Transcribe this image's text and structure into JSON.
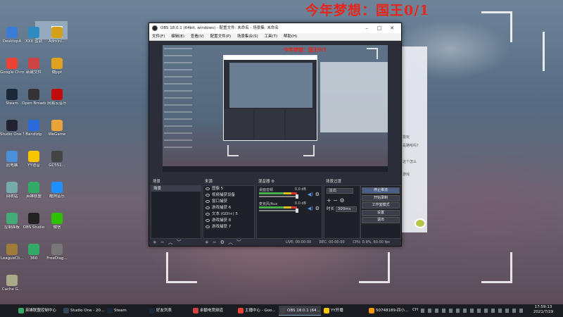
{
  "overlay": {
    "title": "今年梦想：国王0/1"
  },
  "desktop_icons": [
    {
      "label": "DesktopA",
      "color": "#3a7bd5"
    },
    {
      "label": "XXX 蓝调",
      "color": "#2e8bc0"
    },
    {
      "label": "Admini...",
      "color": "#d4a017"
    },
    {
      "label": "Google Chrome",
      "color": "#ea4335"
    },
    {
      "label": "新建文件",
      "color": "#c44"
    },
    {
      "label": "微ppt",
      "color": "#e0a020"
    },
    {
      "label": "Steam",
      "color": "#1b2838"
    },
    {
      "label": "Open Broadcast...",
      "color": "#333"
    },
    {
      "label": "网易云音乐",
      "color": "#c20c0c"
    },
    {
      "label": "Studio One 5",
      "color": "#223"
    },
    {
      "label": "Bandizip",
      "color": "#2a6ad8"
    },
    {
      "label": "WeGame",
      "color": "#e8a33a"
    },
    {
      "label": "此电脑",
      "color": "#4a90d9"
    },
    {
      "label": "YY语音",
      "color": "#f7c600"
    },
    {
      "label": "GC551...",
      "color": "#444"
    },
    {
      "label": "回收站",
      "color": "#7aa"
    },
    {
      "label": "英雄联盟",
      "color": "#3a6"
    },
    {
      "label": "酷狗音乐",
      "color": "#1e90ff"
    },
    {
      "label": "控制面板",
      "color": "#4a7"
    },
    {
      "label": "OBS Studio",
      "color": "#222"
    },
    {
      "label": "微信",
      "color": "#2dc100"
    },
    {
      "label": "LeagueCli...",
      "color": "#a07c3a"
    },
    {
      "label": "360",
      "color": "#3a6"
    },
    {
      "label": "FreeDiag...",
      "color": "#777"
    },
    {
      "label": "Cache G...",
      "color": "#aa8"
    }
  ],
  "obs": {
    "title": "OBS 18.0.1 (64bit, windows) - 配置文件: 未命名 - 场景集: 未命名",
    "menu": [
      "文件(F)",
      "编辑(E)",
      "查看(V)",
      "配置文件(P)",
      "场景集合(S)",
      "工具(T)",
      "帮助(H)"
    ],
    "preview_title": "今年梦想：国王0/1",
    "docks": {
      "scenes": {
        "header": "场景",
        "items": [
          "场景"
        ]
      },
      "sources": {
        "header": "来源",
        "items": [
          "图像 5",
          "视频捕获设备",
          "窗口捕获",
          "游戏捕获 6",
          "文本 (GDI+) 5",
          "游戏捕获 8",
          "游戏捕获 7"
        ]
      },
      "mixer": {
        "header": "混音器",
        "tracks": [
          {
            "name": "桌面音频",
            "db": "0.0 dB"
          },
          {
            "name": "麦克风/Aux",
            "db": "0.0 dB"
          }
        ]
      },
      "transitions": {
        "header": "场景过渡",
        "type": "淡出",
        "duration_label": "时长",
        "duration": "300ms"
      },
      "controls": {
        "buttons": [
          "停止推流",
          "开始录制",
          "工作室模式",
          "设置",
          "退出"
        ]
      }
    },
    "status": {
      "live": "LIVE: 00:00:00",
      "rec": "REC: 00:00:00",
      "cpu": "CPU: 0.9%, 60.00 fps"
    }
  },
  "chat_panel": {
    "lines": [
      "能玩",
      "是路哈吗?",
      "这个怎么",
      "游戏"
    ]
  },
  "taskbar": {
    "items": [
      {
        "label": "英雄联盟控制中心",
        "color": "#3a6"
      },
      {
        "label": "Studio One - 20...",
        "color": "#345"
      },
      {
        "label": "Steam",
        "color": "#1b2838"
      },
      {
        "label": "好友列表",
        "color": "#1b2838"
      },
      {
        "label": "余额电竞频道",
        "color": "#c44"
      },
      {
        "label": "主播中心 - Goo...",
        "color": "#ea4335"
      },
      {
        "label": "OBS 18.0.1 (64...",
        "color": "#444"
      },
      {
        "label": "YY开播",
        "color": "#f7c600"
      },
      {
        "label": "50748189-四小...",
        "color": "#e90"
      }
    ],
    "lang": "CH",
    "time": "17:59:13",
    "date": "2021/7/29"
  }
}
